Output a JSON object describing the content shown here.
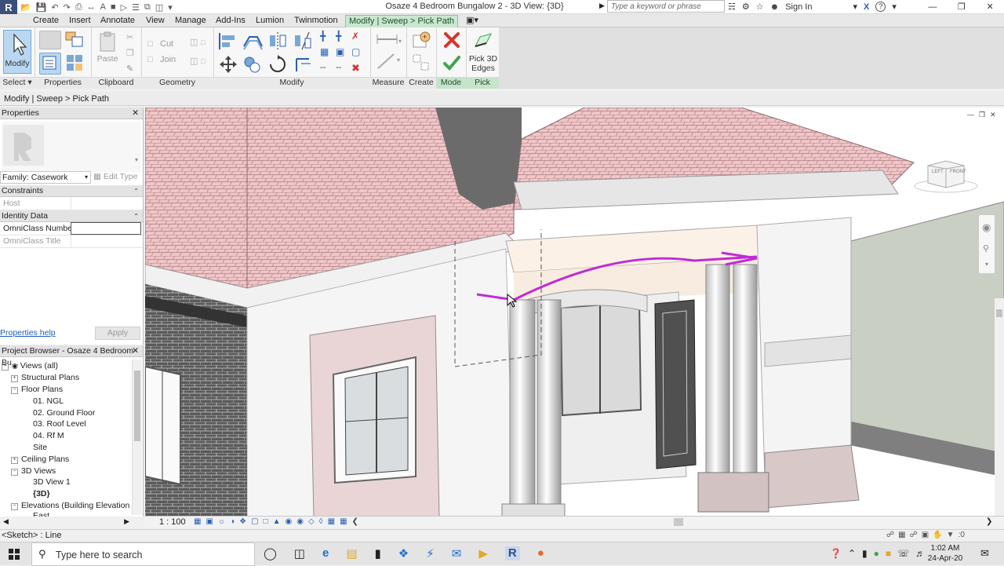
{
  "app": {
    "logo": "R"
  },
  "title": "Osaze 4 Bedroom Bungalow 2 - 3D View: {3D}",
  "search_placeholder": "Type a keyword or phrase",
  "sign_in": "Sign In",
  "help": "?",
  "tabs": [
    "Create",
    "Insert",
    "Annotate",
    "View",
    "Manage",
    "Add-Ins",
    "Lumion",
    "Twinmotion",
    "Modify | Sweep > Pick Path"
  ],
  "ribbon": {
    "modify": "Modify",
    "select": "Select",
    "paste": "Paste",
    "cut": "Cut",
    "join": "Join",
    "panels": [
      "Properties",
      "Clipboard",
      "Geometry",
      "Modify",
      "Measure",
      "Create",
      "Mode",
      "Pick"
    ],
    "pick_3d": "Pick 3D",
    "edges": "Edges"
  },
  "breadcrumb": "Modify | Sweep > Pick Path",
  "properties": {
    "title": "Properties",
    "family": "Family: Casework",
    "edit_type": "Edit Type",
    "sections": [
      "Constraints",
      "Identity Data"
    ],
    "rows": {
      "host": "Host",
      "omniclass_number": "OmniClass Number",
      "omniclass_title": "OmniClass Title"
    },
    "help": "Properties help",
    "apply": "Apply"
  },
  "browser": {
    "title": "Project Browser - Osaze 4 Bedroom Bu...",
    "items": [
      "Views (all)",
      "Structural Plans",
      "Floor Plans",
      "01. NGL",
      "02. Ground Floor",
      "03. Roof Level",
      "04. Rf M",
      "Site",
      "Ceiling Plans",
      "3D Views",
      "3D View 1",
      "{3D}",
      "Elevations (Building Elevation",
      "East"
    ]
  },
  "viewcube": {
    "left": "LEFT",
    "front": "FRONT"
  },
  "view_controls": {
    "scale": "1 : 100"
  },
  "status": {
    "text": "<Sketch> : Line",
    "filter_count": ":0"
  },
  "taskbar": {
    "search": "Type here to search",
    "time": "1:02 AM",
    "date": "24-Apr-20"
  },
  "colors": {
    "accent_tab": "#c9e7d0",
    "sweep_path": "#c02bd6",
    "cancel": "#d9322e",
    "finish": "#3fa34d"
  }
}
